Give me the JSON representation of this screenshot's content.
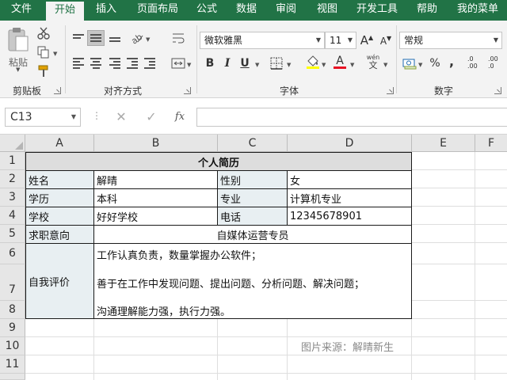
{
  "menu": {
    "tabs": [
      {
        "label": "文件",
        "active": false
      },
      {
        "label": "开始",
        "active": true
      },
      {
        "label": "插入",
        "active": false
      },
      {
        "label": "页面布局",
        "active": false
      },
      {
        "label": "公式",
        "active": false
      },
      {
        "label": "数据",
        "active": false
      },
      {
        "label": "审阅",
        "active": false
      },
      {
        "label": "视图",
        "active": false
      },
      {
        "label": "开发工具",
        "active": false
      },
      {
        "label": "帮助",
        "active": false
      },
      {
        "label": "我的菜单",
        "active": false
      }
    ]
  },
  "ribbon": {
    "clipboard": {
      "label": "剪贴板",
      "paste_label": "粘贴"
    },
    "alignment": {
      "label": "对齐方式"
    },
    "font": {
      "label": "字体",
      "font_name": "微软雅黑",
      "font_size": "11",
      "increase_label": "A",
      "decrease_label": "A",
      "bold": "B",
      "italic": "I",
      "underline": "U",
      "font_color_letter": "A",
      "phonetic_label": "wén",
      "phonetic_sub": "文"
    },
    "number": {
      "label": "数字",
      "format": "常规",
      "percent": "%",
      "comma": ",",
      "inc_decimal": ".00",
      "dec_decimal": ".0"
    }
  },
  "formula_bar": {
    "name_box": "C13",
    "cancel_symbol": "✕",
    "enter_symbol": "✓",
    "fx_symbol": "fx",
    "content": ""
  },
  "sheet": {
    "columns": [
      "A",
      "B",
      "C",
      "D",
      "E",
      "F"
    ],
    "rows": [
      "1",
      "2",
      "3",
      "4",
      "5",
      "6",
      "7",
      "8",
      "9",
      "10",
      "11"
    ],
    "title": "个人简历",
    "cells": {
      "A2": "姓名",
      "B2": "解晴",
      "C2": "性别",
      "D2": "女",
      "A3": "学历",
      "B3": "本科",
      "C3": "专业",
      "D3": "计算机专业",
      "A4": "学校",
      "B4": "好好学校",
      "C4": "电话",
      "D4": "12345678901",
      "A5": "求职意向",
      "B5": "自媒体运营专员",
      "A6": "自我评价",
      "B6_line1": "工作认真负责，数量掌握办公软件；",
      "B6_line2": "善于在工作中发现问题、提出问题、分析问题、解决问题；",
      "B6_line3": "沟通理解能力强，执行力强。"
    },
    "source_note": "图片来源：解晴新生"
  },
  "colors": {
    "excel_green": "#217346",
    "ribbon_bg": "#f3f3f3",
    "label_shade": "#e8eff2",
    "title_shade": "#dddddd",
    "font_color_bar": "#e81123",
    "fill_color_bar": "#ffff00"
  }
}
